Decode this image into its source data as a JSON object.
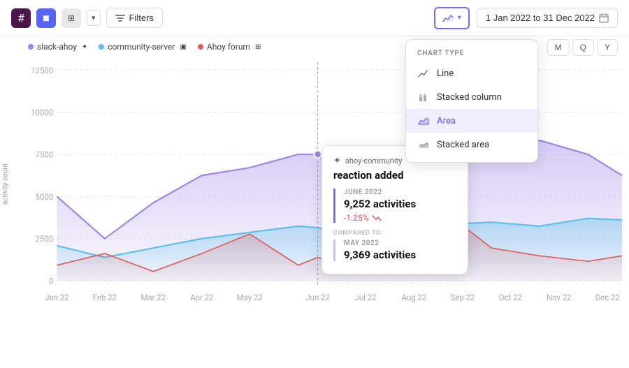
{
  "topbar": {
    "apps": [
      {
        "name": "Slack",
        "icon": "#",
        "label": "slack-icon"
      },
      {
        "name": "Discord",
        "icon": "■",
        "label": "discord-icon"
      },
      {
        "name": "Grid",
        "icon": "⋮⋮",
        "label": "grid-icon"
      }
    ],
    "filters_label": "Filters",
    "chart_type_label": "chart-type",
    "date_range": "1 Jan 2022 to 31 Dec 2022",
    "calendar_icon": "📅"
  },
  "chart_type_dropdown": {
    "section_label": "CHART TYPE",
    "items": [
      {
        "label": "Line",
        "icon": "line",
        "active": false
      },
      {
        "label": "Stacked column",
        "icon": "bar",
        "active": false
      },
      {
        "label": "Area",
        "icon": "area",
        "active": true
      },
      {
        "label": "Stacked area",
        "icon": "stacked-area",
        "active": false
      }
    ]
  },
  "period_buttons": [
    {
      "label": "M",
      "active": false
    },
    {
      "label": "Q",
      "active": false
    },
    {
      "label": "Y",
      "active": false
    }
  ],
  "legend": {
    "items": [
      {
        "label": "slack-ahoy",
        "color": "#a084e8"
      },
      {
        "label": "community-server",
        "color": "#5bc0eb"
      },
      {
        "label": "Ahoy forum",
        "color": "#e05a5a"
      }
    ]
  },
  "y_axis_label": "activity count",
  "x_axis_labels": [
    "Jan 22",
    "Feb 22",
    "Mar 22",
    "Apr 22",
    "May 22",
    "Jun 22",
    "Jul 22",
    "Aug 22",
    "Sep 22",
    "Oct 22",
    "Nov 22",
    "Dec 22"
  ],
  "y_axis_values": [
    "12500",
    "10000",
    "7500",
    "5000",
    "2500",
    "0"
  ],
  "tooltip": {
    "header": "ahoy-community",
    "title": "reaction added",
    "section1_label": "JUNE 2022",
    "section1_value": "9,252 activities",
    "section1_change": "-1.25%",
    "compared_label": "COMPARED TO:",
    "section2_label": "MAY 2022",
    "section2_value": "9,369 activities"
  }
}
